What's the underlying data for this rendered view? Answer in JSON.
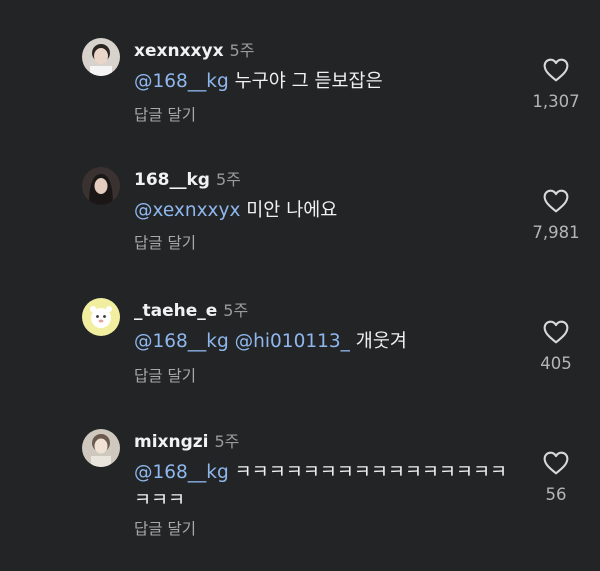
{
  "comments": [
    {
      "username": "xexnxxyx",
      "time": "5주",
      "mentions": [
        "@168__kg"
      ],
      "text": " 누구야 그 듣보잡은",
      "reply_label": "답글 달기",
      "likes": "1,307",
      "avatar_icon": "profile-photo"
    },
    {
      "username": "168__kg",
      "time": "5주",
      "mentions": [
        "@xexnxxyx"
      ],
      "text": " 미안 나에요",
      "reply_label": "답글 달기",
      "likes": "7,981",
      "avatar_icon": "profile-photo"
    },
    {
      "username": "_taehe_e",
      "time": "5주",
      "mentions": [
        "@168__kg",
        "@hi010113_"
      ],
      "text": " 개웃겨",
      "reply_label": "답글 달기",
      "likes": "405",
      "avatar_icon": "profile-photo"
    },
    {
      "username": "mixngzi",
      "time": "5주",
      "mentions": [
        "@168__kg"
      ],
      "text": " ㅋㅋㅋㅋㅋㅋㅋㅋㅋㅋㅋㅋㅋㅋㅋㅋㅋㅋㅋ",
      "reply_label": "답글 달기",
      "likes": "56",
      "avatar_icon": "profile-photo"
    }
  ],
  "colors": {
    "background": "#222426",
    "mention": "#8fb7ee",
    "secondary_text": "#a8a8a8"
  },
  "icons": {
    "like": "heart-outline-icon"
  }
}
